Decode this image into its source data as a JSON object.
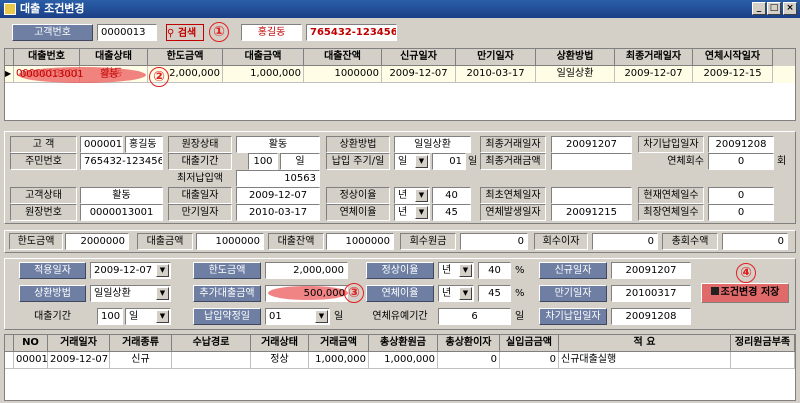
{
  "window": {
    "title": "대출 조건변경",
    "min": "_",
    "max": "□",
    "close": "×"
  },
  "top": {
    "customer_no_label": "고객번호",
    "customer_no": "0000013",
    "search_label": "검색",
    "name": "홍길동",
    "id_no": "765432-1234567"
  },
  "markers": [
    "①",
    "②",
    "③",
    "④"
  ],
  "loan_grid": {
    "headers": [
      "대출번호",
      "대출상태",
      "한도금액",
      "대출금액",
      "대출잔액",
      "신규일자",
      "만기일자",
      "상환방법",
      "최종거래일자",
      "연체시작일자"
    ],
    "rows": [
      [
        "0000013001",
        "활동",
        "2,000,000",
        "1,000,000",
        "1000000",
        "2009-12-07",
        "2010-03-17",
        "일일상환",
        "2009-12-07",
        "2009-12-15"
      ]
    ]
  },
  "info": {
    "customer_label": "고 객",
    "customer_no": "0000013",
    "customer_name": "홍길동",
    "account_status_label": "원장상태",
    "account_status": "활동",
    "repay_method_label": "상환방법",
    "repay_method": "일일상환",
    "last_tx_date_label": "최종거래일자",
    "last_tx_date": "20091207",
    "next_pay_date_label": "차기납입일자",
    "next_pay_date": "20091208",
    "resident_no_label": "주민번호",
    "resident_no": "765432-1234567",
    "loan_period_label": "대출기간",
    "loan_period": "100",
    "loan_period_unit": "일",
    "pay_cycle_label": "납입 주기/일",
    "pay_cycle": "일",
    "pay_day": "01",
    "pay_day_unit": "일",
    "last_tx_amount_label": "최종거래금액",
    "last_tx_amount": "",
    "overdue_count_label": "연체회수",
    "overdue_count": "0",
    "overdue_count_unit": "회",
    "min_pay_label": "최저납입액",
    "min_pay": "10563",
    "cust_status_label": "고객상태",
    "cust_status": "활동",
    "loan_date_label": "대출일자",
    "loan_date": "2009-12-07",
    "normal_rate_label": "정상이율",
    "normal_rate_unit": "년",
    "normal_rate": "40",
    "last_overdue_date_label": "최초연체일자",
    "last_overdue_date": "",
    "cur_overdue_days_label": "현재연체일수",
    "cur_overdue_days": "0",
    "account_no_label": "원장번호",
    "account_no": "0000013001",
    "maturity_label": "만기일자",
    "maturity": "2010-03-17",
    "overdue_rate_label": "연체이율",
    "overdue_rate_unit": "년",
    "overdue_rate": "45",
    "overdue_occur_label": "연체발생일자",
    "overdue_occur": "20091215",
    "total_overdue_days_label": "최장연체일수",
    "total_overdue_days": "0"
  },
  "summary": {
    "limit_label": "한도금액",
    "limit": "2000000",
    "loan_label": "대출금액",
    "loan": "1000000",
    "balance_label": "대출잔액",
    "balance": "1000000",
    "recovered_label": "회수원금",
    "recovered": "0",
    "interest_label": "회수이자",
    "interest": "0",
    "total_label": "총회수액",
    "total": "0"
  },
  "change": {
    "apply_date_label": "적용일자",
    "apply_date": "2009-12-07",
    "limit_label": "한도금액",
    "limit": "2,000,000",
    "normal_rate_label": "정상이율",
    "normal_rate_unit": "년",
    "normal_rate": "40",
    "pct": "%",
    "new_date_label": "신규일자",
    "new_date": "20091207",
    "repay_label": "상환방법",
    "repay": "일일상환",
    "add_loan_label": "추가대출금액",
    "add_loan": "500,000",
    "overdue_rate_label": "연체이율",
    "overdue_rate_unit": "년",
    "overdue_rate": "45",
    "maturity_label": "만기일자",
    "maturity": "20100317",
    "save_label": "조건변경 저장",
    "period_label": "대출기간",
    "period": "100",
    "period_unit": "일",
    "pay_day_label": "납입약정일",
    "pay_day": "01",
    "pay_day_unit": "일",
    "grace_label": "연체유예기간",
    "grace": "6",
    "grace_unit": "일",
    "next_pay_label": "차기납입일자",
    "next_pay": "20091208"
  },
  "tx_grid": {
    "headers": [
      "NO",
      "거래일자",
      "거래종류",
      "수납경로",
      "거래상태",
      "거래금액",
      "총상환원금",
      "총상환이자",
      "실입금금액",
      "적 요",
      "정리원금부족"
    ],
    "rows": [
      [
        "00001",
        "2009-12-07",
        "신규",
        "",
        "정상",
        "1,000,000",
        "1,000,000",
        "0",
        "0",
        "신규대출실행",
        ""
      ]
    ]
  },
  "colors": {
    "accent_label": "#6e7fa3",
    "selected_row": "#fffde6",
    "marker": "#e02020"
  }
}
